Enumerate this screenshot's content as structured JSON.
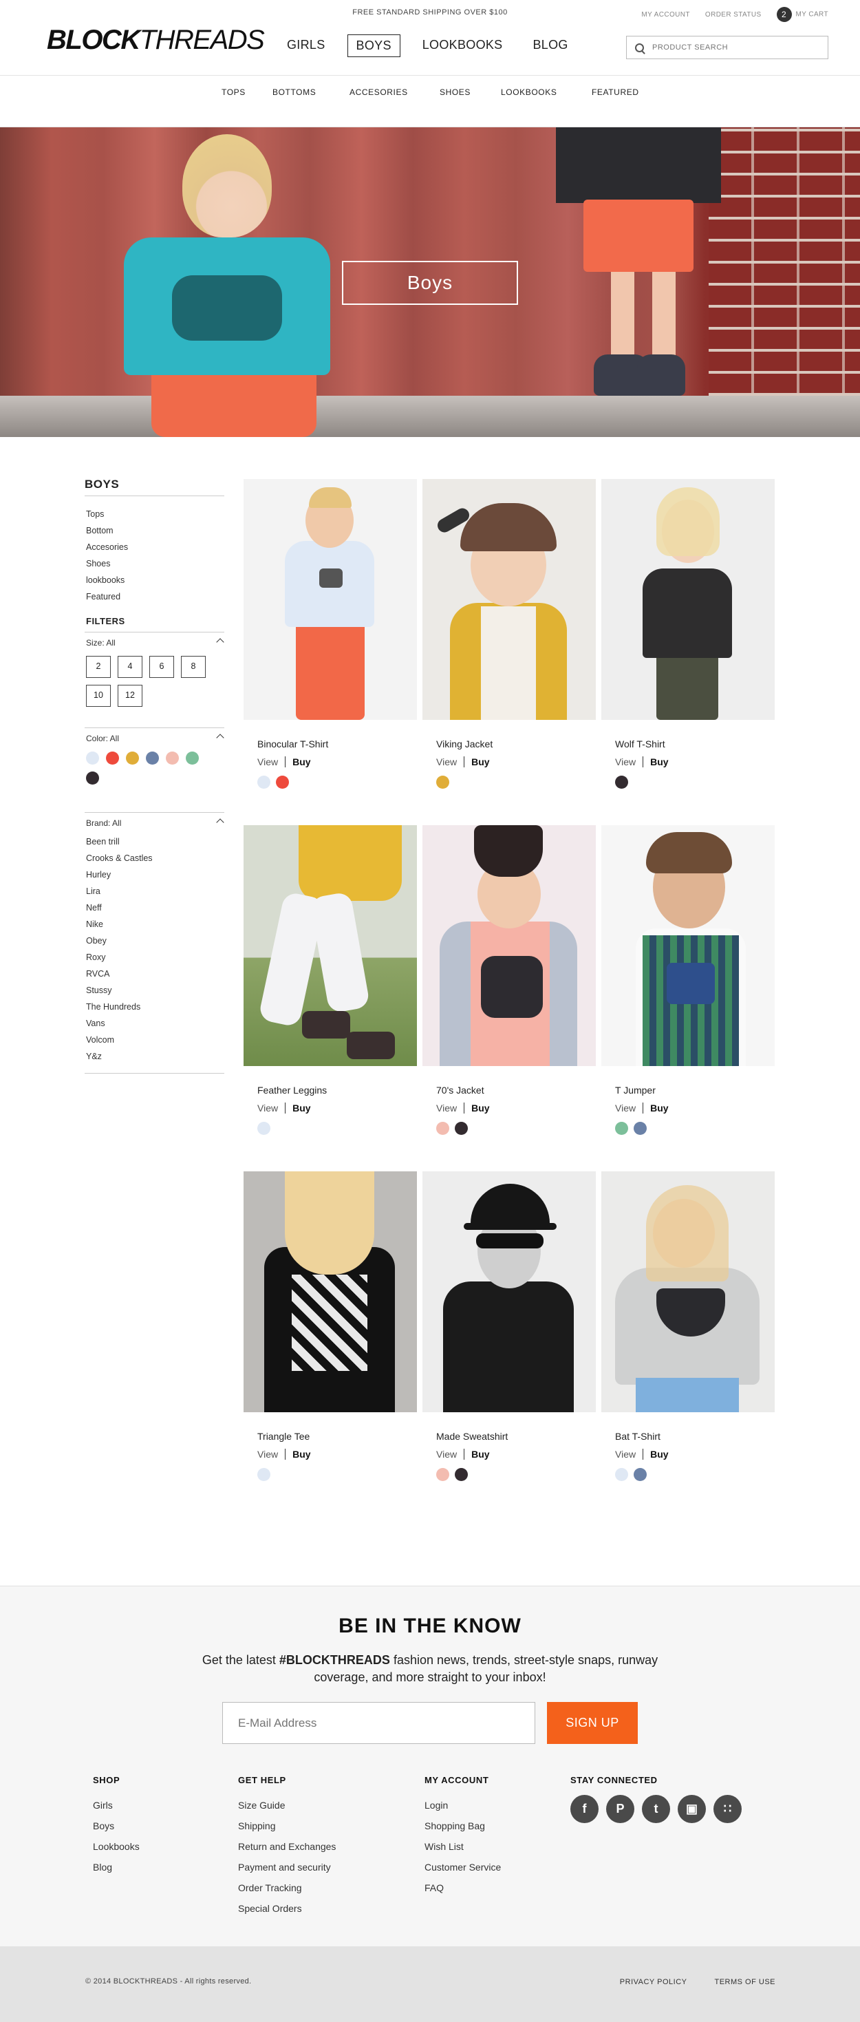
{
  "header": {
    "promo": "FREE STANDARD SHIPPING OVER $100",
    "logo_bold": "BLOCK",
    "logo_light": "THREADS",
    "my_account": "MY ACCOUNT",
    "order_status": "ORDER STATUS",
    "cart_count": "2",
    "my_cart": "MY CART",
    "nav": [
      "GIRLS",
      "BOYS",
      "LOOKBOOKS",
      "BLOG"
    ],
    "active_nav": "BOYS",
    "search_placeholder": "PRODUCT SEARCH"
  },
  "subnav": [
    "TOPS",
    "BOTTOMS",
    "ACCESORIES",
    "SHOES",
    "LOOKBOOKS",
    "FEATURED"
  ],
  "hero": {
    "title": "Boys"
  },
  "sidebar": {
    "title": "BOYS",
    "categories": [
      "Tops",
      "Bottom",
      "Accesories",
      "Shoes",
      "lookbooks",
      "Featured"
    ],
    "filters_title": "FILTERS",
    "size_label": "Size: All",
    "sizes": [
      "2",
      "4",
      "6",
      "8",
      "10",
      "12"
    ],
    "color_label": "Color: All",
    "colors": [
      "#dfe8f4",
      "#ee4a3c",
      "#e0ad38",
      "#6a81a7",
      "#f3bcb0",
      "#7cbf9a",
      "#332b30"
    ],
    "brand_label": "Brand: All",
    "brands": [
      "Been trill",
      "Crooks & Castles",
      "Hurley",
      "Lira",
      "Neff",
      "Nike",
      "Obey",
      "Roxy",
      "RVCA",
      "Stussy",
      "The Hundreds",
      "Vans",
      "Volcom",
      "Y&z"
    ]
  },
  "products": [
    {
      "name": "Binocular T-Shirt",
      "view": "View",
      "buy": "Buy",
      "colors": [
        "#dfe8f4",
        "#ee4a3c"
      ]
    },
    {
      "name": "Viking Jacket",
      "view": "View",
      "buy": "Buy",
      "colors": [
        "#e0ad38"
      ]
    },
    {
      "name": "Wolf T-Shirt",
      "view": "View",
      "buy": "Buy",
      "colors": [
        "#332b30"
      ]
    },
    {
      "name": "Feather Leggins",
      "view": "View",
      "buy": "Buy",
      "colors": [
        "#dfe8f4"
      ]
    },
    {
      "name": "70's Jacket",
      "view": "View",
      "buy": "Buy",
      "colors": [
        "#f3bcb0",
        "#332b30"
      ]
    },
    {
      "name": "T Jumper",
      "view": "View",
      "buy": "Buy",
      "colors": [
        "#7cbf9a",
        "#6a81a7"
      ]
    },
    {
      "name": "Triangle Tee",
      "view": "View",
      "buy": "Buy",
      "colors": [
        "#dfe8f4"
      ]
    },
    {
      "name": "Made Sweatshirt",
      "view": "View",
      "buy": "Buy",
      "colors": [
        "#f3bcb0",
        "#332b30"
      ]
    },
    {
      "name": "Bat T-Shirt",
      "view": "View",
      "buy": "Buy",
      "colors": [
        "#dfe8f4",
        "#6a81a7"
      ]
    }
  ],
  "newsletter": {
    "title": "BE IN THE KNOW",
    "text_before": "Get the latest ",
    "hashtag": "#BLOCKTHREADS",
    "text_after": " fashion news, trends, street-style snaps, runway coverage, and more straight to your inbox!",
    "placeholder": "E-Mail Address",
    "button": "SIGN UP"
  },
  "footer": {
    "shop": {
      "title": "SHOP",
      "links": [
        "Girls",
        "Boys",
        "Lookbooks",
        "Blog"
      ]
    },
    "help": {
      "title": "GET HELP",
      "links": [
        "Size Guide",
        "Shipping",
        "Return and Exchanges",
        "Payment and security",
        "Order Tracking",
        "Special Orders"
      ]
    },
    "account": {
      "title": "MY ACCOUNT",
      "links": [
        "Login",
        "Shopping Bag",
        "Wish List",
        "Customer Service",
        "FAQ"
      ]
    },
    "social": {
      "title": "STAY CONNECTED",
      "icons": [
        "facebook-icon",
        "pinterest-icon",
        "twitter-icon",
        "instagram-icon",
        "apps-icon"
      ]
    },
    "copyright": "© 2014 BLOCKTHREADS - All rights reserved.",
    "privacy": "PRIVACY POLICY",
    "terms": "TERMS OF USE"
  },
  "colors": {
    "accent": "#f4611b",
    "dark": "#222222",
    "footer_bg": "#f6f6f6",
    "bottom_bar": "#e3e3e3"
  }
}
